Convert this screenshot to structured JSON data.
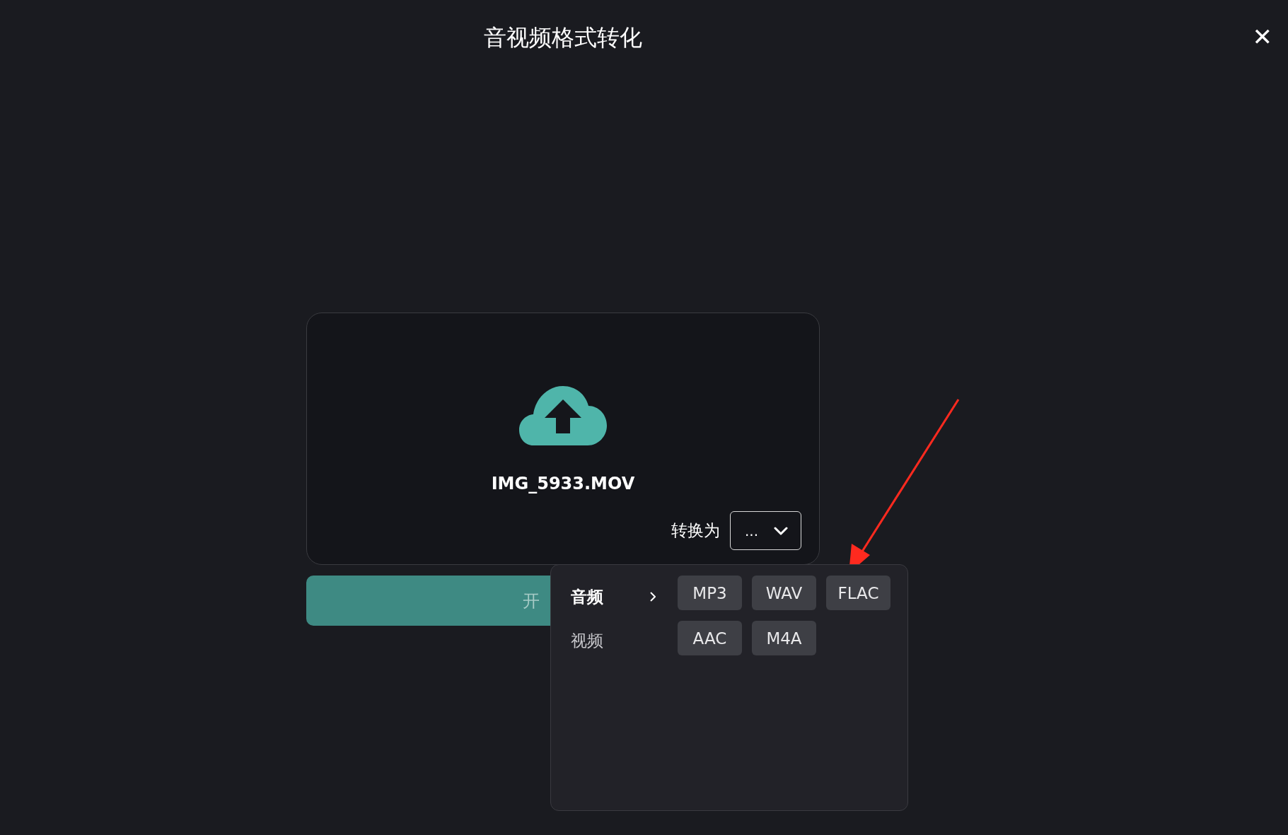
{
  "window": {
    "title": "音视频格式转化",
    "close": "✕"
  },
  "upload": {
    "filename": "IMG_5933.MOV",
    "convert_label": "转换为",
    "dropdown_value": "..."
  },
  "start_button": {
    "label": "开"
  },
  "menu": {
    "categories": [
      {
        "label": "音频",
        "selected": true
      },
      {
        "label": "视频",
        "selected": false
      }
    ],
    "formats": [
      "MP3",
      "WAV",
      "FLAC",
      "AAC",
      "M4A"
    ]
  },
  "annotation": {
    "kind": "arrow",
    "color": "#ff2a1f"
  }
}
